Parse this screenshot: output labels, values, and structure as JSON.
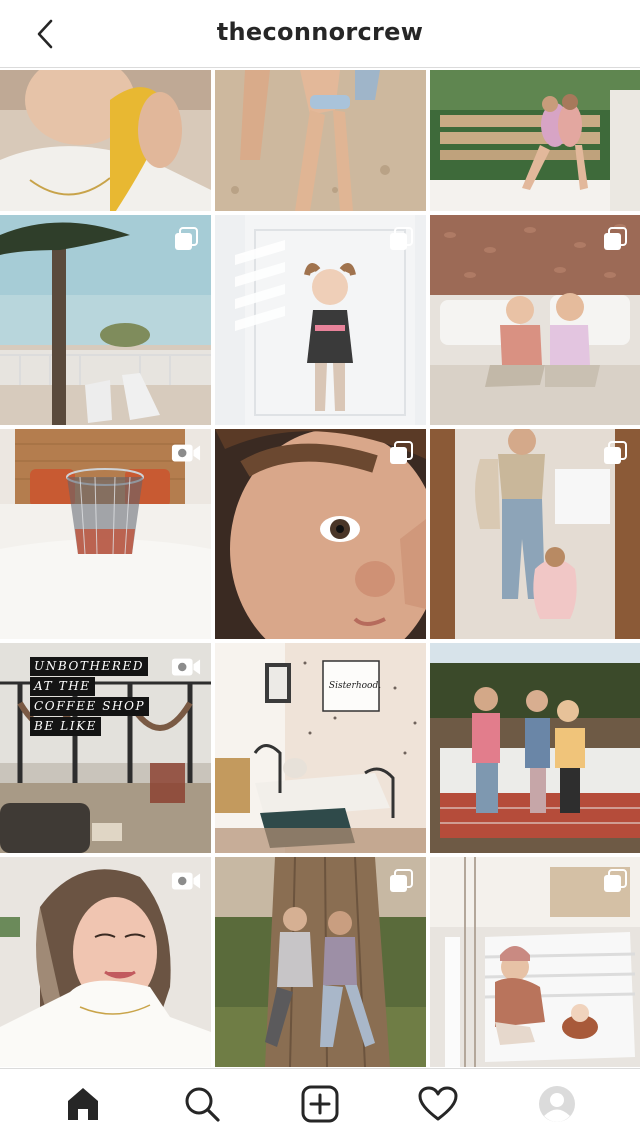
{
  "header": {
    "title": "theconnorcrew",
    "back_icon": "chevron-left-icon"
  },
  "grid": {
    "posts": [
      {
        "name": "post-1",
        "badge": null,
        "description_hidden": true
      },
      {
        "name": "post-2",
        "badge": null
      },
      {
        "name": "post-3",
        "badge": null
      },
      {
        "name": "post-4",
        "badge": "carousel-icon"
      },
      {
        "name": "post-5",
        "badge": "carousel-icon"
      },
      {
        "name": "post-6",
        "badge": "carousel-icon"
      },
      {
        "name": "post-7",
        "badge": "video-icon"
      },
      {
        "name": "post-8",
        "badge": "carousel-icon"
      },
      {
        "name": "post-9",
        "badge": "carousel-icon"
      },
      {
        "name": "post-10",
        "badge": "video-icon"
      },
      {
        "name": "post-11",
        "badge": null
      },
      {
        "name": "post-12",
        "badge": null
      },
      {
        "name": "post-13",
        "badge": "video-icon"
      },
      {
        "name": "post-14",
        "badge": "carousel-icon"
      },
      {
        "name": "post-15",
        "badge": "carousel-icon"
      }
    ],
    "post10_text": [
      "UNBOTHERED",
      "AT THE",
      "COFFEE SHOP",
      "BE LIKE"
    ],
    "post11_sign": "Sisterhood."
  },
  "tabbar": {
    "items": [
      "home-icon",
      "search-icon",
      "new-post-icon",
      "activity-heart-icon",
      "profile-avatar-icon"
    ],
    "active": "home-icon"
  },
  "colors": {
    "text": "#262626",
    "border": "#dbdbdb",
    "background": "#ffffff"
  }
}
